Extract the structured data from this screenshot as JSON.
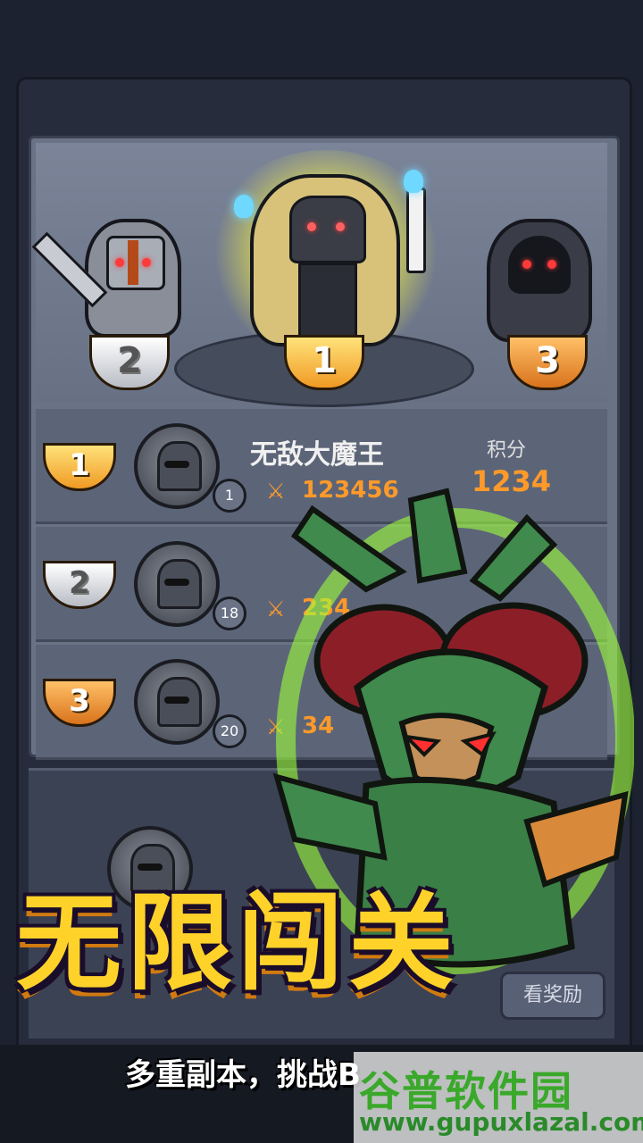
{
  "podium": {
    "rank1": "1",
    "rank2": "2",
    "rank3": "3"
  },
  "leaderboard": {
    "score_label": "积分",
    "rows": [
      {
        "rank": "1",
        "name": "无敌大魔王",
        "level": "1",
        "power": "123456",
        "score": "1234"
      },
      {
        "rank": "2",
        "level": "18",
        "power": "234"
      },
      {
        "rank": "3",
        "level": "20",
        "power": "34"
      }
    ]
  },
  "buttons": {
    "reward": "看奖励"
  },
  "promo": {
    "title": "无限闯关",
    "subtitle": "多重副本，挑战B"
  },
  "watermark": {
    "name": "谷普软件园",
    "url": "www.gupuxlazal.com"
  },
  "colors": {
    "accent": "#ff9a2a",
    "gold": "#ffd22a",
    "monster_glow": "#9dff3a"
  },
  "icons": [
    "sword-icon",
    "medal-icon",
    "knight-avatar-icon"
  ]
}
